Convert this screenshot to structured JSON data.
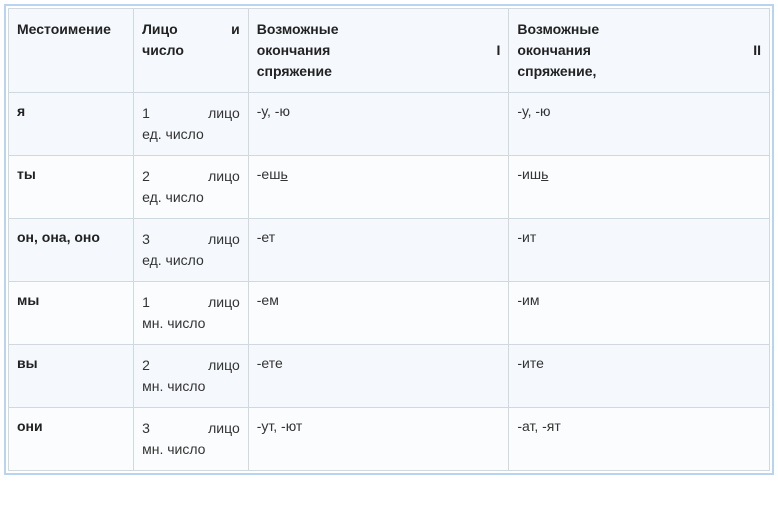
{
  "headers": {
    "pronoun": "Местоимение",
    "person_number_l1": "Лицо и",
    "person_number_l2": "число",
    "conj1_l1": "Возможные",
    "conj1_l2": "окончания I",
    "conj1_l3": "спряжение",
    "conj2_l1": "Возможные",
    "conj2_l2": "окончания II",
    "conj2_l3": "спряжение,"
  },
  "rows": [
    {
      "pronoun": "я",
      "person_l1": "1 лицо",
      "person_l2": "ед. число",
      "conj1": "-у, -ю",
      "conj2": "-у, -ю"
    },
    {
      "pronoun": "ты",
      "person_l1": "2 лицо",
      "person_l2": "ед. число",
      "conj1_pre": "-еш",
      "conj1_u": "ь",
      "conj2_pre": "-иш",
      "conj2_u": "ь"
    },
    {
      "pronoun": "он, она, оно",
      "person_l1": "3 лицо",
      "person_l2": "ед. число",
      "conj1": "-ет",
      "conj2": "-ит"
    },
    {
      "pronoun": "мы",
      "person_l1": "1 лицо",
      "person_l2": "мн. число",
      "conj1": "-ем",
      "conj2": "-им"
    },
    {
      "pronoun": "вы",
      "person_l1": "2 лицо",
      "person_l2": "мн. число",
      "conj1": "-ете",
      "conj2": "-ите"
    },
    {
      "pronoun": "они",
      "person_l1": "3 лицо",
      "person_l2": "мн. число",
      "conj1": "-ут, -ют",
      "conj2": "-ат, -ят"
    }
  ]
}
